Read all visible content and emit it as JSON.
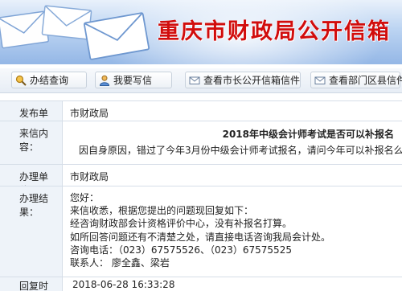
{
  "banner": {
    "title": "重庆市财政局公开信箱"
  },
  "toolbar": {
    "buttons": [
      {
        "label": "办结查询",
        "icon": "magnifier-icon"
      },
      {
        "label": "我要写信",
        "icon": "user-icon"
      },
      {
        "label": "查看市长公开信箱信件",
        "icon": "envelope-icon"
      },
      {
        "label": "查看部门区县信件",
        "icon": "envelope-icon"
      }
    ]
  },
  "detail": {
    "sender_label": "发布单位：",
    "sender_value": "市财政局",
    "letter_label": "来信内容：",
    "letter_subject": "2018年中级会计师考试是否可以补报名",
    "letter_body": "因自身原因，错过了今年3月份中级会计师考试报名，请问今年可以补报名么？",
    "handler_label": "办理单位：",
    "handler_value": "市财政局",
    "result_label": "办理结果：",
    "result_lines": [
      "您好：",
      "来信收悉，根据您提出的问题现回复如下：",
      "经咨询财政部会计资格评价中心，没有补报名打算。",
      "如所回答问题还有不清楚之处，请直接电话咨询我局会计处。",
      "咨询电话：（023）67575526、（023）67575525",
      "联系人：  廖全鑫、梁岩"
    ],
    "reply_time_label": "回复时间：",
    "reply_time_value": "2018-06-28 16:33:28"
  }
}
